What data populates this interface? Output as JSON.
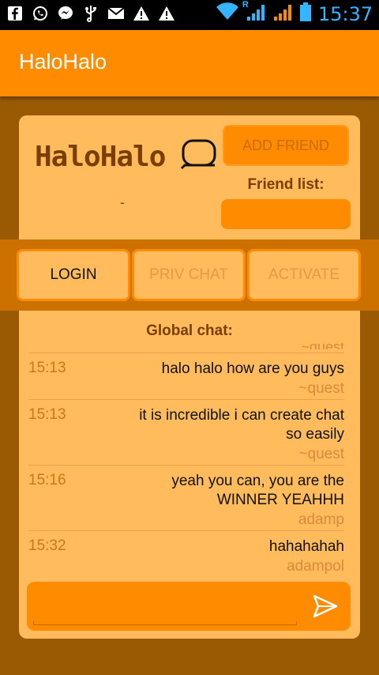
{
  "status_bar": {
    "time": "15:37",
    "icons": [
      "facebook-icon",
      "whatsapp-icon",
      "messenger-icon",
      "usb-icon",
      "mail-icon",
      "warning-icon",
      "warning-icon",
      "wifi-icon",
      "signal-icon",
      "signal-icon",
      "battery-icon"
    ],
    "roaming_mark": "R"
  },
  "app_bar": {
    "title": "HaloHalo"
  },
  "header": {
    "logo_text": "HaloHalo",
    "status_text": "-",
    "add_friend_label": "ADD FRIEND",
    "friend_list_label": "Friend list:"
  },
  "tabs": [
    {
      "label": "LOGIN",
      "enabled": true
    },
    {
      "label": "PRIV CHAT",
      "enabled": false
    },
    {
      "label": "ACTIVATE",
      "enabled": false
    }
  ],
  "chat": {
    "title": "Global chat:",
    "partial_user": "~quest",
    "messages": [
      {
        "time": "15:13",
        "text": "halo halo how are you guys",
        "user": "~quest"
      },
      {
        "time": "15:13",
        "text": "it is incredible i can create chat so easily",
        "user": "~quest"
      },
      {
        "time": "15:16",
        "text": "yeah you can, you are the WINNER YEAHHH",
        "user": "adamp"
      },
      {
        "time": "15:32",
        "text": "hahahahah",
        "user": "adampol"
      }
    ]
  },
  "composer": {
    "value": "",
    "send_icon": "send-icon"
  },
  "colors": {
    "primary": "#ff8c00",
    "background": "#9a5a04",
    "card": "#ffbb5c",
    "band": "#cc7000",
    "clock": "#35b4ff"
  }
}
